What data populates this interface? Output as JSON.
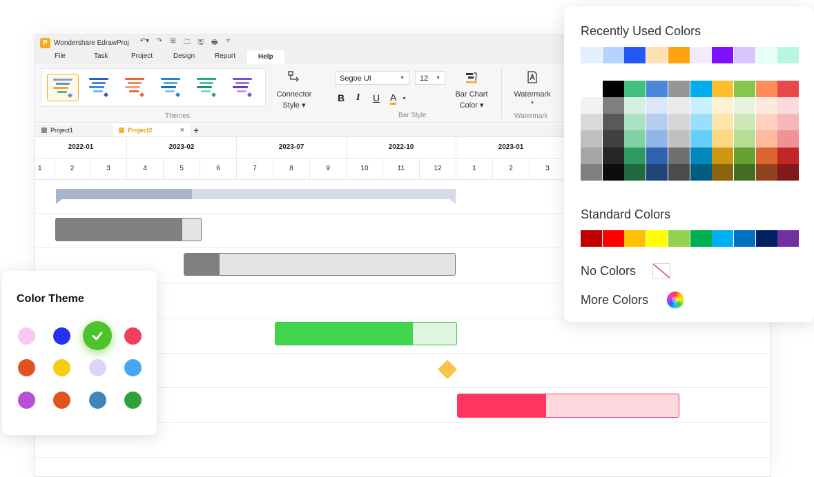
{
  "app": {
    "title": "Wondershare EdrawProj",
    "logo": "P",
    "quick_access": [
      "↶▾",
      "↷",
      "⊞",
      "🗀",
      "🖫",
      "🖶",
      "▿"
    ]
  },
  "menu": [
    "File",
    "Task",
    "Project",
    "Design",
    "Report",
    "Help"
  ],
  "ribbon": {
    "themes_label": "Themes",
    "connector_label_1": "Connector",
    "connector_label_2": "Style ▾",
    "font_name": "Segoe UI",
    "font_size": "12",
    "bold": "B",
    "italic": "I",
    "underline": "U",
    "font_color": "A",
    "bar_style_label": "Bar Style",
    "bar_chart_label_1": "Bar Chart",
    "bar_chart_label_2": "Color ▾",
    "watermark_label": "Watermark",
    "watermark_caret": "▾",
    "watermark_group": "Watermark"
  },
  "tabs": [
    {
      "label": "Project1",
      "active": false
    },
    {
      "label": "Project2",
      "active": true
    }
  ],
  "tab_close": "×",
  "tab_add": "+",
  "timeline": {
    "years": [
      "2022-01",
      "2023-02",
      "2023-07",
      "2022-10",
      "2023-01"
    ],
    "months": [
      "1",
      "2",
      "3",
      "4",
      "5",
      "6",
      "7",
      "8",
      "9",
      "10",
      "11",
      "12",
      "1",
      "2",
      "3"
    ]
  },
  "gantt_bars": [
    {
      "type": "summary",
      "progress": 0.34,
      "color": "#a7b4cc",
      "bg": "#d5dbe7"
    },
    {
      "type": "task",
      "progress": 0.87,
      "color": "#808080",
      "bg": "#e4e4e4"
    },
    {
      "type": "task",
      "progress": 0.13,
      "color": "#808080",
      "bg": "#e4e4e4"
    },
    {
      "type": "task",
      "progress": 0.76,
      "color": "#3fd54c",
      "bg": "#dff5df"
    },
    {
      "type": "milestone",
      "color": "#f7c548"
    },
    {
      "type": "task",
      "progress": 0.4,
      "color": "#ff3560",
      "bg": "#ffd7df"
    }
  ],
  "color_palette": {
    "recent_title": "Recently Used Colors",
    "recent": [
      "#e3efff",
      "#b5d4fd",
      "#2358f5",
      "#fde1b2",
      "#ffa210",
      "#f0ecfd",
      "#7e12ff",
      "#d9c5fb",
      "#e6fff7",
      "#b7f7df"
    ],
    "theme_columns": [
      [
        "#ffffff",
        "#f2f2f2",
        "#d9d9d9",
        "#bfbfbf",
        "#a6a6a6",
        "#7f7f7f"
      ],
      [
        "#000000",
        "#7f7f7f",
        "#595959",
        "#404040",
        "#262626",
        "#0d0d0d"
      ],
      [
        "#42c07f",
        "#d5f0e2",
        "#abe1c5",
        "#81d2a8",
        "#2d9a62",
        "#1f6a43"
      ],
      [
        "#4a86d9",
        "#dbe6f7",
        "#b7cdef",
        "#92b5e8",
        "#2e63b0",
        "#204478"
      ],
      [
        "#969696",
        "#eaeaea",
        "#d5d5d5",
        "#c0c0c0",
        "#707070",
        "#4b4b4b"
      ],
      [
        "#00aeef",
        "#ccefff",
        "#99dffb",
        "#66cff6",
        "#0089bd",
        "#005c7e"
      ],
      [
        "#fbbf2e",
        "#fef2d5",
        "#fde5ab",
        "#fdd882",
        "#cf9612",
        "#8a640c"
      ],
      [
        "#86c64e",
        "#e7f3dc",
        "#cfe8b9",
        "#b6dc95",
        "#65a232",
        "#446d21"
      ],
      [
        "#ff8c5a",
        "#ffe8de",
        "#ffd1bd",
        "#ffba9c",
        "#d9652f",
        "#91431f"
      ],
      [
        "#e84a4a",
        "#fadbdb",
        "#f5b7b7",
        "#f19292",
        "#c22727",
        "#811a1a"
      ]
    ],
    "standard_title": "Standard Colors",
    "standard": [
      "#c00000",
      "#ff0000",
      "#ffc000",
      "#ffff00",
      "#92d050",
      "#00b050",
      "#00b0f0",
      "#0070c0",
      "#002060",
      "#7030a0"
    ],
    "no_colors_label": "No Colors",
    "more_colors_label": "More Colors"
  },
  "color_theme": {
    "title": "Color Theme",
    "dots": [
      "#f8c9f6",
      "#2431f0",
      "#4ec22b",
      "#f33d5f",
      "#e2511f",
      "#f7cc12",
      "#dcd5f8",
      "#45a6f4",
      "#b84fd6",
      "#e1541e",
      "#3f86bf",
      "#2ea33a"
    ],
    "selected_index": 2
  }
}
